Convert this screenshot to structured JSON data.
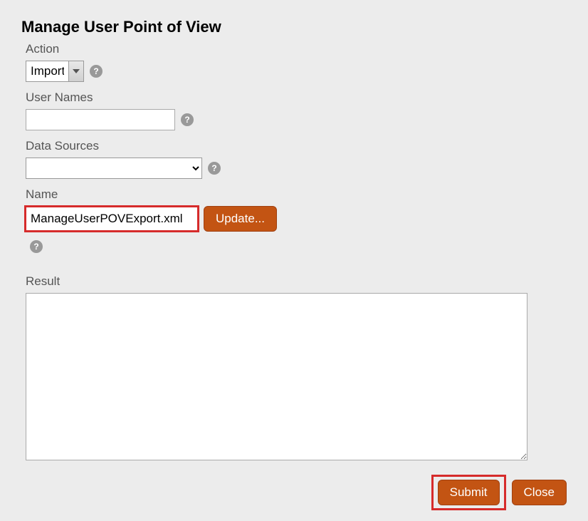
{
  "dialog": {
    "title": "Manage User Point of View"
  },
  "fields": {
    "action": {
      "label": "Action",
      "value": "Import"
    },
    "userNames": {
      "label": "User Names",
      "value": ""
    },
    "dataSources": {
      "label": "Data Sources",
      "value": ""
    },
    "name": {
      "label": "Name",
      "value": "ManageUserPOVExport.xml"
    },
    "result": {
      "label": "Result",
      "value": ""
    }
  },
  "buttons": {
    "update": "Update...",
    "submit": "Submit",
    "close": "Close"
  },
  "icons": {
    "help": "?"
  }
}
